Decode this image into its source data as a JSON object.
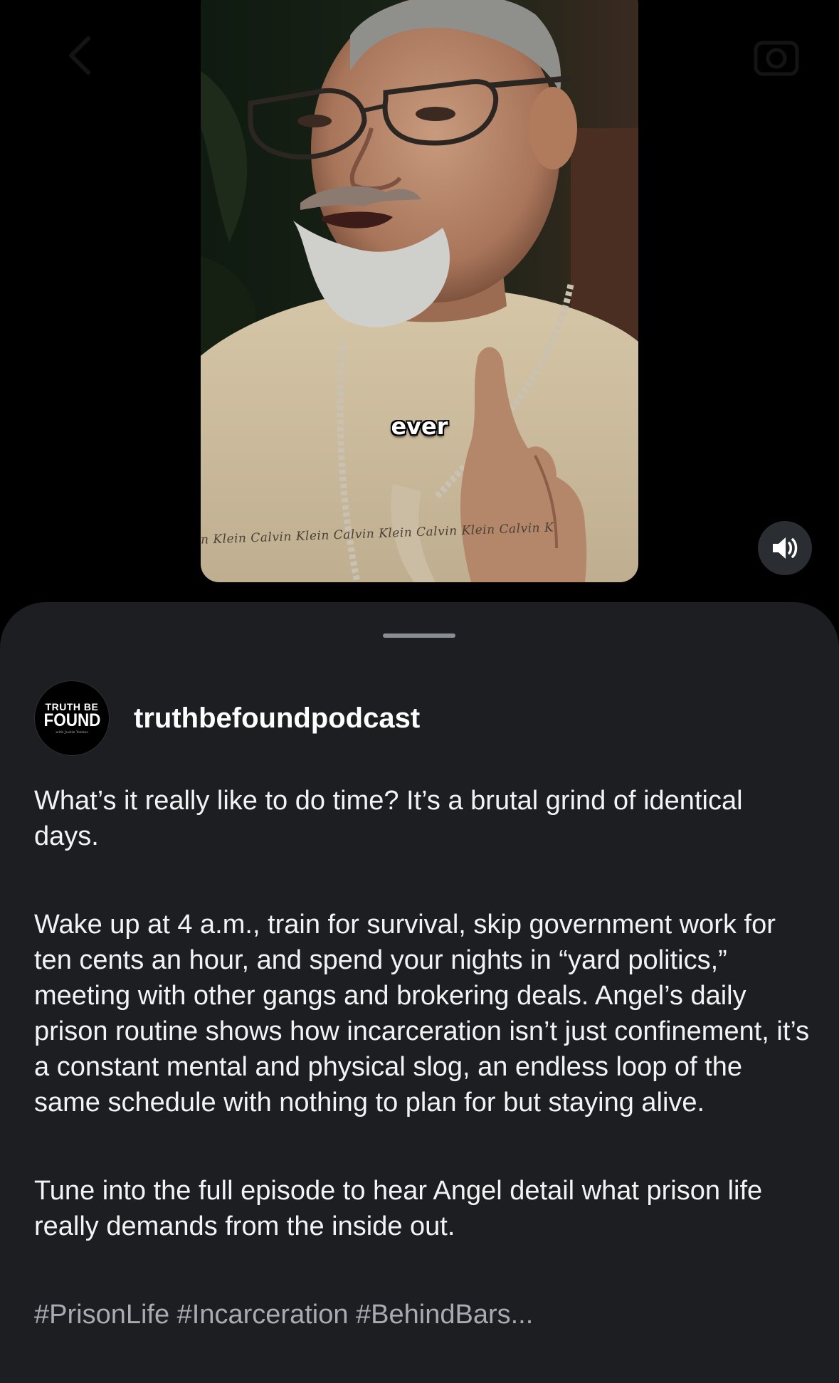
{
  "video": {
    "caption": "ever",
    "brand_tape_text": "n Klein  Calvin Klein  Calvin Klein  Calvin Klein  Calvin K"
  },
  "top_bar": {
    "back_icon": "chevron-left-icon",
    "camera_icon": "camera-icon"
  },
  "mute_button": {
    "icon": "speaker-icon",
    "state": "sound-on"
  },
  "post": {
    "avatar": {
      "line1": "TRUTH BE",
      "line2": "FOUND",
      "line3": "with Justin Yantes"
    },
    "username": "truthbefoundpodcast",
    "paragraphs": [
      "What’s it really like to do time? It’s a brutal grind of identical days.",
      "Wake up at 4 a.m., train for survival, skip government work for ten cents an hour, and spend your nights in “yard politics,” meeting with other gangs and brokering deals. Angel’s daily prison routine shows how incarceration isn’t just confinement, it’s a constant mental and physical slog, an endless loop of the same schedule with nothing to plan for but staying alive.",
      "Tune into the full episode to hear Angel detail what prison life really demands from the inside out."
    ],
    "hashtags": "#PrisonLife #Incarceration #BehindBars..."
  },
  "colors": {
    "sheet_background": "#1c1e21",
    "text_primary": "#f2f3f5",
    "text_secondary": "#a8abb0",
    "mute_button_bg": "#2a2d31"
  }
}
